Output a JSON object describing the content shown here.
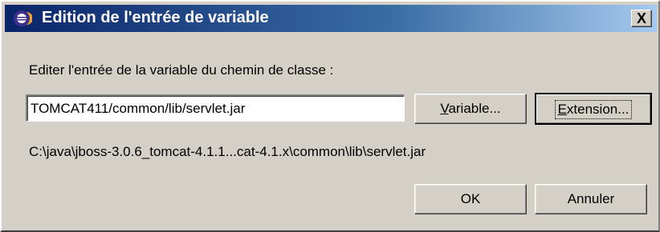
{
  "window": {
    "title": "Edition de l'entrée de variable",
    "icon": "eclipse-icon",
    "close_label": "X",
    "colors": {
      "titlebar_start": "#0a246a",
      "titlebar_end": "#a6caf0",
      "face": "#d4d0c8"
    }
  },
  "form": {
    "prompt": "Editer l'entrée de la variable du chemin de classe :",
    "path_value": "TOMCAT411/common/lib/servlet.jar",
    "resolved_path": "C:\\java\\jboss-3.0.6_tomcat-4.1.1...cat-4.1.x\\common\\lib\\servlet.jar"
  },
  "buttons": {
    "variable": {
      "mnemonic": "V",
      "rest": "ariable..."
    },
    "extension": {
      "mnemonic": "E",
      "rest": "xtension..."
    },
    "ok": "OK",
    "cancel": "Annuler"
  }
}
